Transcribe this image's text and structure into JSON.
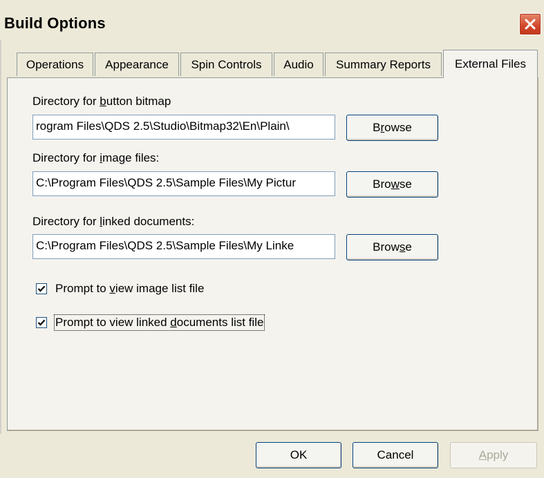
{
  "window": {
    "title": "Build Options",
    "close_icon": "close-icon"
  },
  "tabs": [
    {
      "label": "Operations"
    },
    {
      "label": "Appearance"
    },
    {
      "label": "Spin Controls"
    },
    {
      "label": "Audio"
    },
    {
      "label": "Summary Reports"
    },
    {
      "label": "External Files",
      "active": true
    }
  ],
  "fields": {
    "button_bitmap": {
      "label_pre": "Directory for ",
      "label_u": "b",
      "label_post": "utton bitmap",
      "value": "rogram Files\\QDS 2.5\\Studio\\Bitmap32\\En\\Plain\\",
      "browse_pre": "B",
      "browse_u": "r",
      "browse_post": "owse"
    },
    "image_files": {
      "label_pre": "Directory for ",
      "label_u": "i",
      "label_post": "mage files:",
      "value": "C:\\Program Files\\QDS 2.5\\Sample Files\\My Pictur",
      "browse_pre": "Bro",
      "browse_u": "w",
      "browse_post": "se"
    },
    "linked_documents": {
      "label_pre": "Directory for ",
      "label_u": "l",
      "label_post": "inked documents:",
      "value": "C:\\Program Files\\QDS 2.5\\Sample Files\\My Linke",
      "browse_pre": "Brow",
      "browse_u": "s",
      "browse_post": "e"
    }
  },
  "checkboxes": {
    "image_list": {
      "checked": true,
      "pre": "Prompt to ",
      "u": "v",
      "post": "iew image list file"
    },
    "linked_list": {
      "checked": true,
      "pre": "Prompt to view linked ",
      "u": "d",
      "post": "ocuments list file"
    }
  },
  "footer": {
    "ok": "OK",
    "cancel": "Cancel",
    "apply_u": "A",
    "apply_post": "pply"
  },
  "colors": {
    "dialog_bg": "#ece9d8",
    "panel_bg": "#f4f3ee",
    "close_red": "#d2462a"
  }
}
